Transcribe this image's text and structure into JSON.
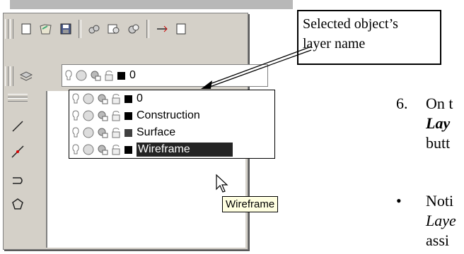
{
  "callout": {
    "line1": "Selected object’s",
    "line2": "layer name"
  },
  "layer_control": {
    "current_layer": "0"
  },
  "layer_list": [
    {
      "name": "0",
      "color": "#000000"
    },
    {
      "name": "Construction",
      "color": "#000000"
    },
    {
      "name": "Surface",
      "color": "#404040"
    },
    {
      "name": "Wireframe",
      "color": "#000000",
      "selected": true
    }
  ],
  "tooltip": {
    "text": "Wireframe"
  },
  "document": {
    "step_number": "6.",
    "step_text": "On t",
    "step_text2": "Lay",
    "step_text3": "butt",
    "bullet": "•",
    "bullet_text": "Noti",
    "bullet_text2": "Laye",
    "bullet_text3": "assi"
  },
  "colors": {
    "toolbar_bg": "#d4d0c8",
    "selection": "#242424",
    "tooltip_bg": "#ffffe1"
  }
}
